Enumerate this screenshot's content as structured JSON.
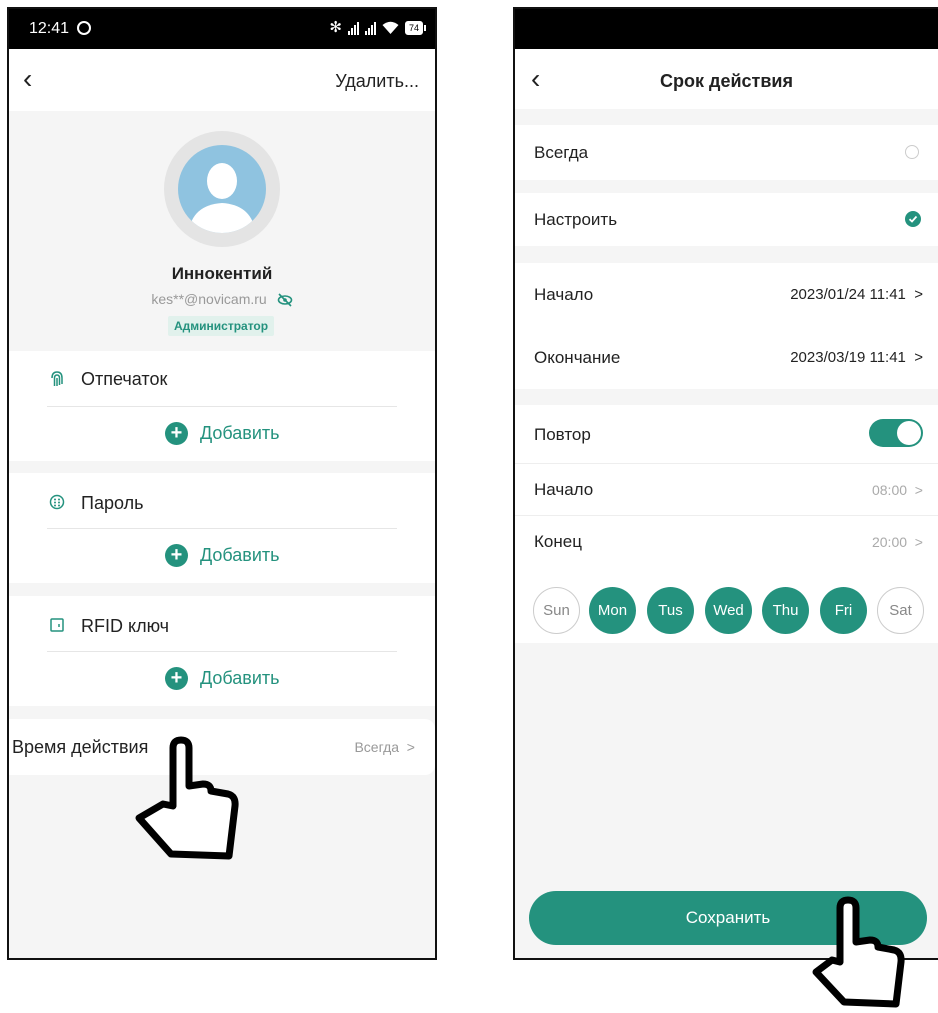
{
  "left_screen": {
    "status_bar": {
      "time": "12:41",
      "battery": "74"
    },
    "header": {
      "delete_label": "Удалить..."
    },
    "profile": {
      "name": "Иннокентий",
      "email": "kes**@novicam.ru",
      "role": "Администратор"
    },
    "sections": {
      "fingerprint": {
        "title": "Отпечаток",
        "add_label": "Добавить"
      },
      "password": {
        "title": "Пароль",
        "add_label": "Добавить"
      },
      "rfid": {
        "title": "RFID ключ",
        "add_label": "Добавить"
      }
    },
    "validity": {
      "label": "Время действия",
      "value": "Всегда"
    }
  },
  "right_screen": {
    "header": {
      "title": "Срок действия"
    },
    "options": {
      "always": {
        "label": "Всегда",
        "selected": false
      },
      "custom": {
        "label": "Настроить",
        "selected": true
      }
    },
    "period": {
      "start_label": "Начало",
      "start_value": "2023/01/24 11:41",
      "end_label": "Окончание",
      "end_value": "2023/03/19 11:41"
    },
    "repeat": {
      "label": "Повтор",
      "enabled": true,
      "start_label": "Начало",
      "start_value": "08:00",
      "end_label": "Конец",
      "end_value": "20:00"
    },
    "days": [
      {
        "label": "Sun",
        "on": false
      },
      {
        "label": "Mon",
        "on": true
      },
      {
        "label": "Tus",
        "on": true
      },
      {
        "label": "Wed",
        "on": true
      },
      {
        "label": "Thu",
        "on": true
      },
      {
        "label": "Fri",
        "on": true
      },
      {
        "label": "Sat",
        "on": false
      }
    ],
    "save_label": "Сохранить"
  },
  "colors": {
    "accent": "#24927e",
    "avatar_blue": "#8fc3e0",
    "background": "#f5f5f5"
  }
}
